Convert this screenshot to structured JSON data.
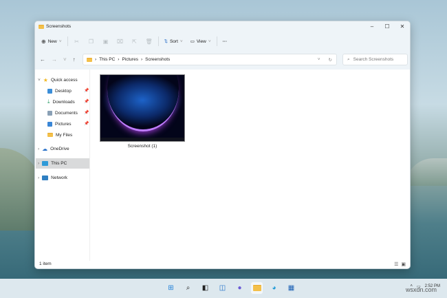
{
  "window": {
    "title": "Screenshots",
    "controls": {
      "minimize": "–",
      "maximize": "☐",
      "close": "✕"
    }
  },
  "toolbar": {
    "new_label": "New",
    "sort_label": "Sort",
    "view_label": "View",
    "more": "···"
  },
  "address": {
    "crumbs": [
      "This PC",
      "Pictures",
      "Screenshots"
    ],
    "search_placeholder": "Search Screenshots"
  },
  "sidebar": {
    "quick_access": "Quick access",
    "items": [
      {
        "label": "Desktop",
        "color": "#3b8ed8"
      },
      {
        "label": "Downloads",
        "color": "#2f9e6a"
      },
      {
        "label": "Documents",
        "color": "#8aa0b5"
      },
      {
        "label": "Pictures",
        "color": "#3a86d6"
      },
      {
        "label": "My Files",
        "color": "#f3c04a"
      }
    ],
    "onedrive": "OneDrive",
    "this_pc": "This PC",
    "network": "Network"
  },
  "files": [
    {
      "name": "Screenshot (1)"
    }
  ],
  "status": {
    "count": "1 item"
  },
  "taskbar": {
    "time": "2:52 PM"
  },
  "watermark": "wsxdn.com"
}
